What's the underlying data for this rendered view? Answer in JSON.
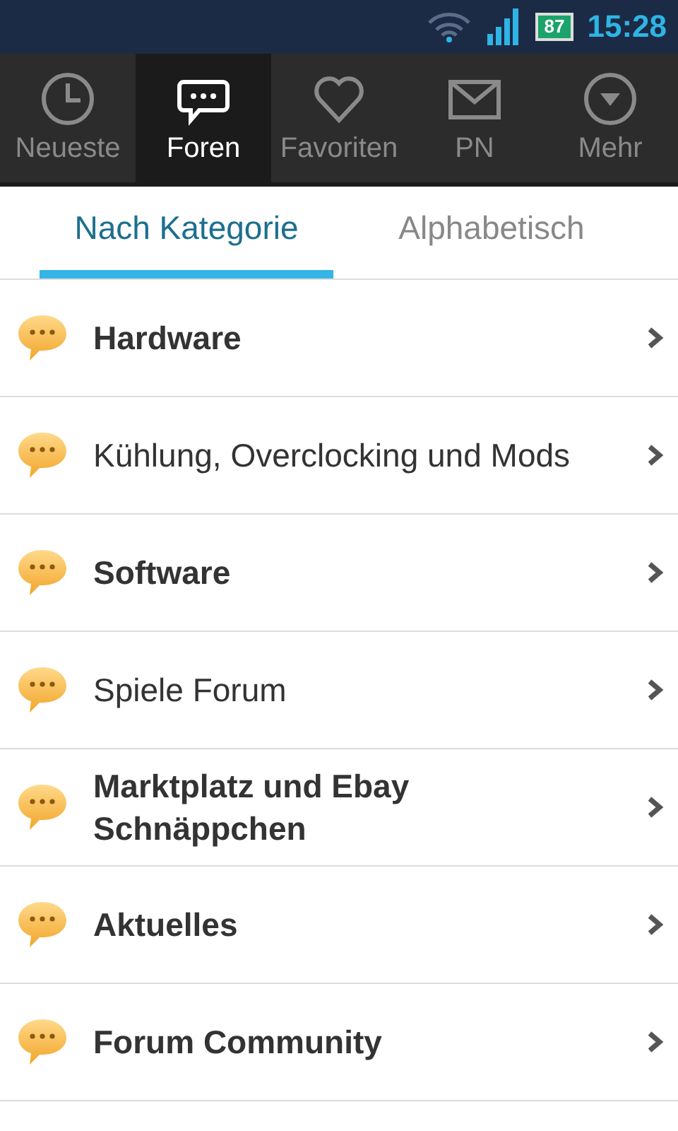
{
  "status_bar": {
    "battery": "87",
    "time": "15:28"
  },
  "nav_tabs": [
    {
      "label": "Neueste",
      "kind": "clock",
      "selected": false
    },
    {
      "label": "Foren",
      "kind": "chat",
      "selected": true
    },
    {
      "label": "Favoriten",
      "kind": "heart",
      "selected": false
    },
    {
      "label": "PN",
      "kind": "mail",
      "selected": false
    },
    {
      "label": "Mehr",
      "kind": "more",
      "selected": false
    }
  ],
  "sub_tabs": [
    {
      "label": "Nach Kategorie",
      "selected": true
    },
    {
      "label": "Alphabetisch",
      "selected": false
    }
  ],
  "forums": [
    {
      "title": "Hardware",
      "unread": true
    },
    {
      "title": "Kühlung, Overclocking und Mods",
      "unread": false
    },
    {
      "title": "Software",
      "unread": true
    },
    {
      "title": "Spiele Forum",
      "unread": false
    },
    {
      "title": "Marktplatz und Ebay Schnäppchen",
      "unread": true
    },
    {
      "title": "Aktuelles",
      "unread": true
    },
    {
      "title": "Forum Community",
      "unread": true
    }
  ]
}
